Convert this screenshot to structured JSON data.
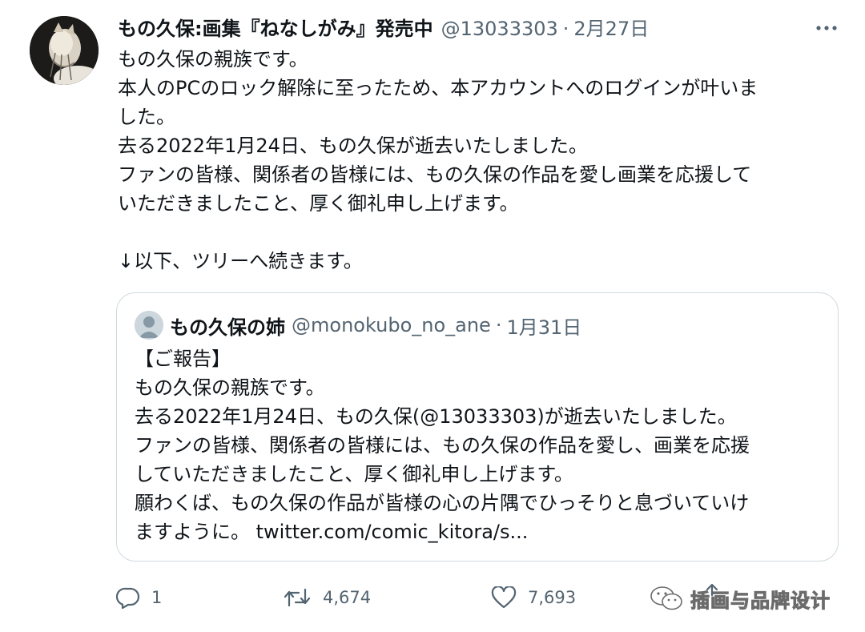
{
  "tweet": {
    "author": {
      "display_name": "もの久保:画集『ねなしがみ』発売中",
      "handle": "@13033303",
      "date": "2月27日",
      "separator": "·"
    },
    "body_lines": [
      "もの久保の親族です。",
      "本人のPCのロック解除に至ったため、本アカウントへのログインが叶いま",
      "した。",
      "去る2022年1月24日、もの久保が逝去いたしました。",
      "ファンの皆様、関係者の皆様には、もの久保の作品を愛し画業を応援して",
      "いただきましたこと、厚く御礼申し上げます。",
      "",
      "↓以下、ツリーへ続きます。"
    ],
    "more_icon": "more-horizontal-icon"
  },
  "quote": {
    "display_name": "もの久保の姉",
    "handle": "@monokubo_no_ane",
    "separator": "·",
    "date": "1月31日",
    "lines": [
      "【ご報告】",
      "もの久保の親族です。",
      "去る2022年1月24日、もの久保(@13033303)が逝去いたしました。",
      "ファンの皆様、関係者の皆様には、もの久保の作品を愛し、画業を応援",
      "していただきましたこと、厚く御礼申し上げます。",
      "願わくば、もの久保の作品が皆様の心の片隅でひっそりと息づいていけ",
      "ますように。 twitter.com/comic_kitora/s..."
    ]
  },
  "actions": {
    "reply_count": "1",
    "retweet_count": "4,674",
    "like_count": "7,693"
  },
  "watermark": {
    "text": "插画与品牌设计"
  },
  "colors": {
    "text": "#0f1419",
    "secondary": "#536471",
    "border": "#cfd9de"
  }
}
